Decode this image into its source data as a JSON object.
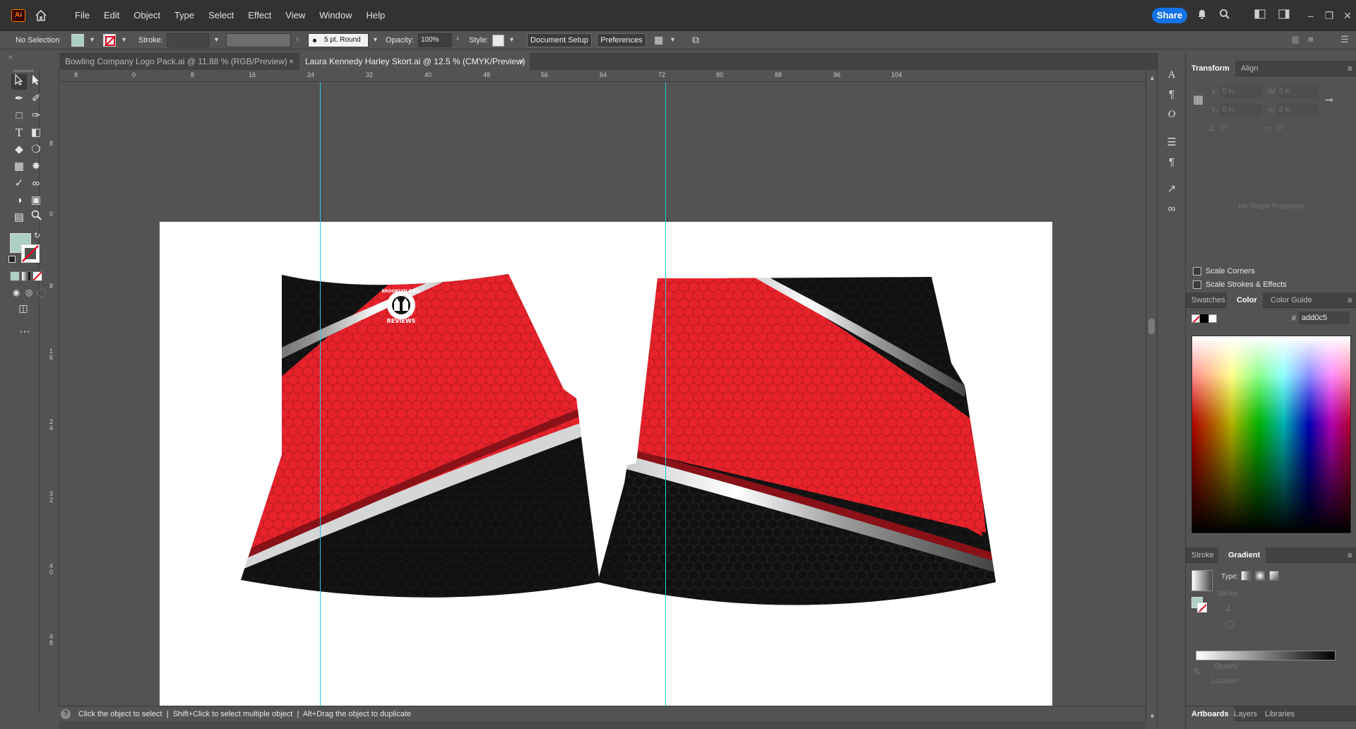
{
  "app": {
    "logo": "Ai",
    "menu": [
      "File",
      "Edit",
      "Object",
      "Type",
      "Select",
      "Effect",
      "View",
      "Window",
      "Help"
    ],
    "share_label": "Share",
    "icons": {
      "home": "home-icon",
      "bell": "bell-icon",
      "search": "search-icon",
      "arrange": "arrange-documents-icon",
      "workspace": "workspace-icon"
    }
  },
  "control_bar": {
    "selection": "No Selection",
    "stroke_label": "Stroke:",
    "brush": "5 pt. Round",
    "opacity_label": "Opacity:",
    "opacity_value": "100%",
    "style_label": "Style:",
    "document_setup": "Document Setup",
    "preferences": "Preferences"
  },
  "tabs": [
    {
      "label": "Bowling Company Logo Pack.ai @ 11.88 % (RGB/Preview)",
      "close": "×",
      "active": false
    },
    {
      "label": "Laura Kennedy Harley Skort.ai @ 12.5 % (CMYK/Preview)",
      "close": "×",
      "active": true
    }
  ],
  "rulers": {
    "horizontal": [
      "8",
      "0",
      "8",
      "16",
      "24",
      "32",
      "40",
      "48",
      "56",
      "64",
      "72",
      "80",
      "88",
      "96",
      "104"
    ],
    "vertical": [
      "8",
      "0",
      "8",
      "1\n6",
      "2\n4",
      "3\n2",
      "4\n0",
      "4\n8"
    ]
  },
  "artwork": {
    "logo_top": "BROOKLYN BALL",
    "logo_bottom": "REVIEWS",
    "colors": {
      "red": "#e8222b",
      "black": "#111111",
      "silver": "#d9d9d9",
      "guide": "#28c8e6"
    }
  },
  "status": {
    "help": "?",
    "text": "Click the object to select  |  Shift+Click to select multiple object  |  Alt+Drag the object to duplicate"
  },
  "transform": {
    "tabs": [
      "Transform",
      "Align"
    ],
    "x_label": "X:",
    "x_value": "0 in",
    "y_label": "Y:",
    "y_value": "0 in",
    "w_label": "W:",
    "w_value": "0 in",
    "h_label": "H:",
    "h_value": "0 in",
    "angle": "0°",
    "shear": "0°",
    "empty": "No Shape Properties",
    "scale_corners": "Scale Corners",
    "scale_strokes": "Scale Strokes & Effects"
  },
  "color": {
    "tabs": [
      "Swatches",
      "Color",
      "Color Guide"
    ],
    "hash": "#",
    "hex": "add0c5",
    "fill": "#add0c5"
  },
  "gradient": {
    "tabs": [
      "Stroke",
      "Gradient"
    ],
    "type_label": "Type:",
    "stroke_label": "Stroke:",
    "opacity_label": "Opacity:",
    "location_label": "Location:"
  },
  "bottom_panels": {
    "tabs": [
      "Artboards",
      "Layers",
      "Libraries"
    ]
  }
}
